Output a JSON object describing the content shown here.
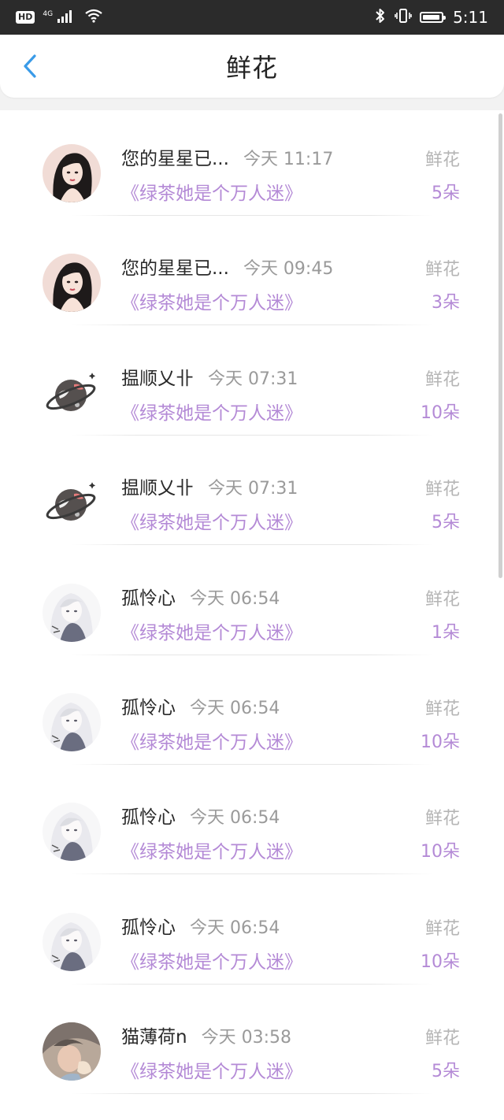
{
  "status_bar": {
    "hd": "HD",
    "network": "4G",
    "time": "5:11"
  },
  "header": {
    "title": "鲜花"
  },
  "items": [
    {
      "name": "您的星星已...",
      "time": "今天 11:17",
      "book": "《绿茶她是个万人迷》",
      "label": "鲜花",
      "count": "5朵",
      "avatar": "girl-portrait"
    },
    {
      "name": "您的星星已...",
      "time": "今天 09:45",
      "book": "《绿茶她是个万人迷》",
      "label": "鲜花",
      "count": "3朵",
      "avatar": "girl-portrait"
    },
    {
      "name": "揾顺乂卝",
      "time": "今天 07:31",
      "book": "《绿茶她是个万人迷》",
      "label": "鲜花",
      "count": "10朵",
      "avatar": "planet"
    },
    {
      "name": "揾顺乂卝",
      "time": "今天 07:31",
      "book": "《绿茶她是个万人迷》",
      "label": "鲜花",
      "count": "5朵",
      "avatar": "planet"
    },
    {
      "name": "孤怜心",
      "time": "今天 06:54",
      "book": "《绿茶她是个万人迷》",
      "label": "鲜花",
      "count": "1朵",
      "avatar": "anime-girl"
    },
    {
      "name": "孤怜心",
      "time": "今天 06:54",
      "book": "《绿茶她是个万人迷》",
      "label": "鲜花",
      "count": "10朵",
      "avatar": "anime-girl"
    },
    {
      "name": "孤怜心",
      "time": "今天 06:54",
      "book": "《绿茶她是个万人迷》",
      "label": "鲜花",
      "count": "10朵",
      "avatar": "anime-girl"
    },
    {
      "name": "孤怜心",
      "time": "今天 06:54",
      "book": "《绿茶她是个万人迷》",
      "label": "鲜花",
      "count": "10朵",
      "avatar": "anime-girl"
    },
    {
      "name": "猫薄荷n",
      "time": "今天 03:58",
      "book": "《绿茶她是个万人迷》",
      "label": "鲜花",
      "count": "5朵",
      "avatar": "photo"
    }
  ],
  "colors": {
    "accent": "#b48ad6",
    "back_arrow": "#3a9be8",
    "status_bar": "#2b2b2b"
  }
}
